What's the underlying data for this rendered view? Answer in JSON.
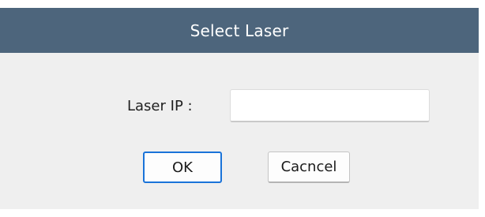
{
  "dialog": {
    "title": "Select Laser",
    "field_label": "Laser IP :",
    "ip_value": "",
    "ok_label": "OK",
    "cancel_label": "Cacncel"
  },
  "colors": {
    "titlebar": "#4d657c",
    "title_text": "#ffffff",
    "background": "#efefef",
    "ok_focus_border": "#1a73d9"
  }
}
